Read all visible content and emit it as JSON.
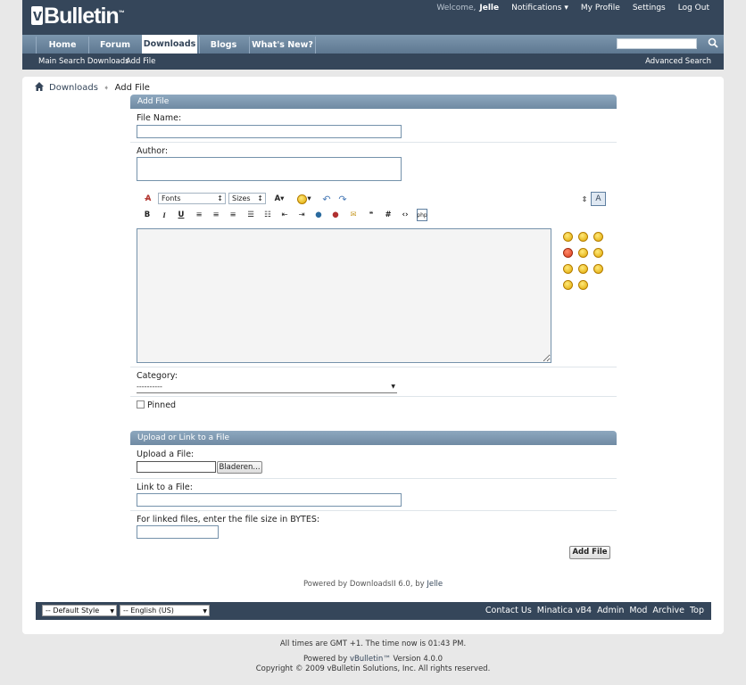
{
  "header": {
    "logo": "vBulletin",
    "welcome_label": "Welcome,",
    "username": "Jelle",
    "links": [
      "Notifications",
      "My Profile",
      "Settings",
      "Log Out"
    ]
  },
  "nav": {
    "tabs": [
      "Home",
      "Forum",
      "Downloads",
      "Blogs",
      "What's New?"
    ],
    "active_tab": "Downloads",
    "search_placeholder": ""
  },
  "subnav": {
    "items": [
      "Main",
      "Search Downloads",
      "Add File"
    ],
    "advanced_search": "Advanced Search"
  },
  "breadcrumb": {
    "items": [
      "Downloads",
      "Add File"
    ]
  },
  "add_file": {
    "heading": "Add File",
    "file_name_label": "File Name:",
    "file_name_value": "",
    "author_label": "Author:",
    "author_value": "",
    "editor": {
      "font_select": "Fonts",
      "size_select": "Sizes",
      "text_value": ""
    },
    "category_label": "Category:",
    "category_value": "----------",
    "pinned_label": "Pinned",
    "pinned_checked": false
  },
  "upload": {
    "heading": "Upload or Link to a File",
    "upload_label": "Upload a File:",
    "browse_button": "Bladeren...",
    "link_label": "Link to a File:",
    "size_label": "For linked files, enter the file size in BYTES:",
    "submit_button": "Add File"
  },
  "powered": {
    "text": "Powered by DownloadsII 6.0, by",
    "author": "Jelle"
  },
  "footer": {
    "style_select": "-- Default Style",
    "language_select": "-- English (US)",
    "links": [
      "Contact Us",
      "Minatica vB4",
      "Admin",
      "Mod",
      "Archive",
      "Top"
    ]
  },
  "bottom": {
    "time_text": "All times are GMT +1. The time now is",
    "time_value": "01:43 PM.",
    "powered_prefix": "Powered by",
    "powered_link": "vBulletin™",
    "powered_suffix": "Version 4.0.0",
    "copyright": "Copyright © 2009 vBulletin Solutions, Inc. All rights reserved."
  },
  "colors": {
    "header": "#35465a",
    "navbar": "#6f8aa3",
    "link": "#35465a"
  }
}
